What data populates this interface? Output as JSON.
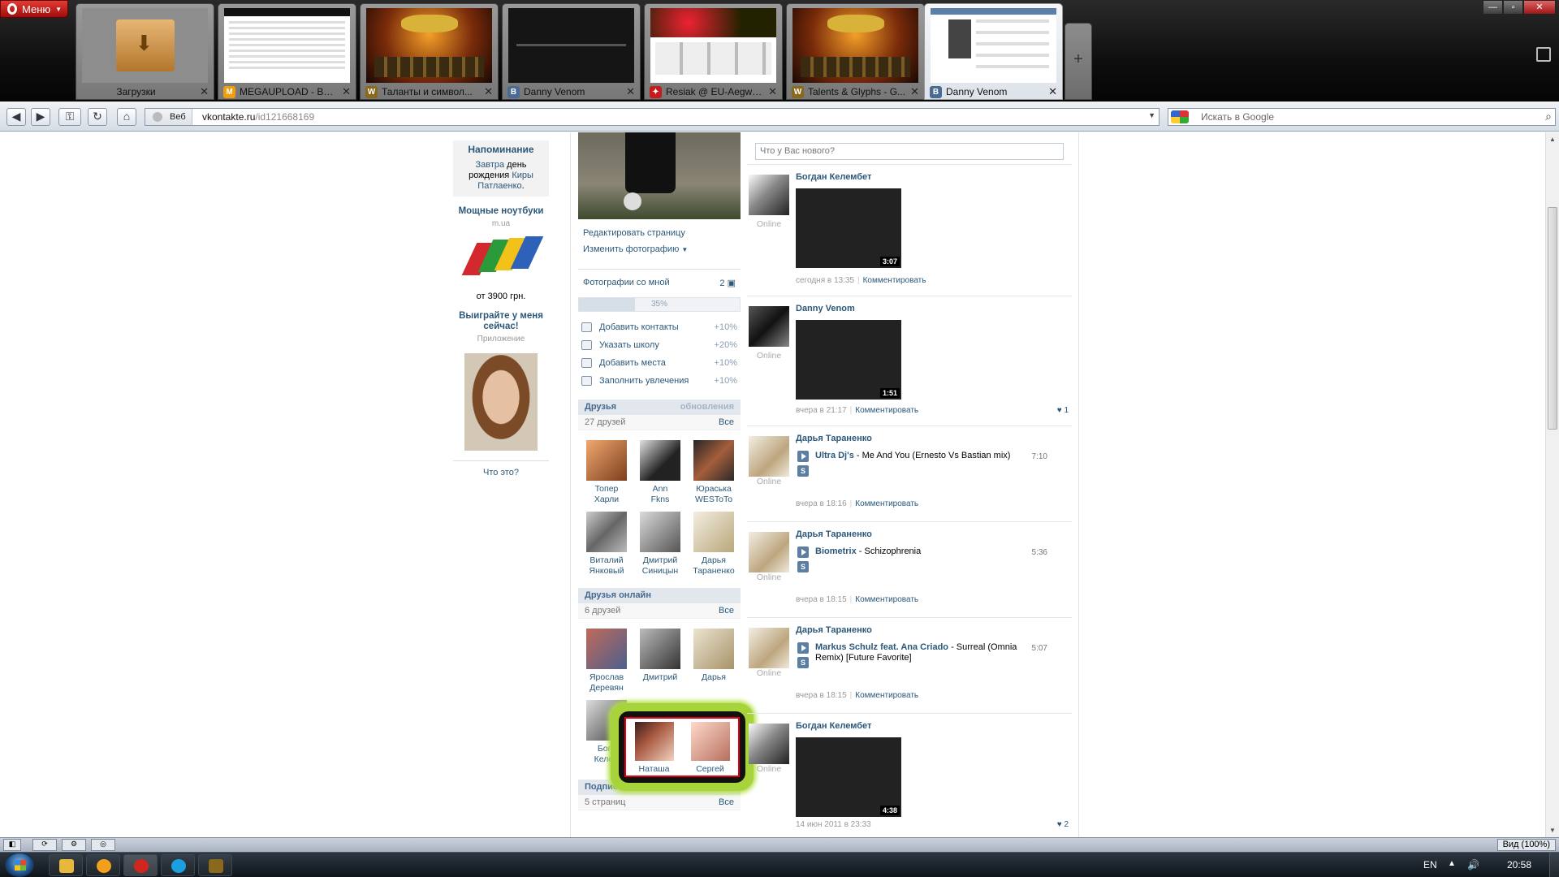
{
  "browser": {
    "menu_label": "Меню",
    "tabs": [
      {
        "label": "Загрузки",
        "favicon": "",
        "kind": "downloads",
        "has_close": true
      },
      {
        "label": "MEGAUPLOAD - Вед...",
        "favicon": "M",
        "favicon_color": "#f29d0b",
        "kind": "mega",
        "has_close": true
      },
      {
        "label": "Таланты и символ...",
        "favicon": "W",
        "favicon_color": "#8a6a1a",
        "kind": "wow",
        "has_close": true
      },
      {
        "label": "Danny Venom",
        "favicon": "B",
        "favicon_color": "#4a6c94",
        "kind": "dark",
        "has_close": true
      },
      {
        "label": "Resiak @ EU-Aegwy...",
        "favicon": "✦",
        "favicon_color": "#c21c1c",
        "kind": "resiak",
        "has_close": true
      },
      {
        "label": "Talents & Glyphs - G...",
        "favicon": "W",
        "favicon_color": "#8a6a1a",
        "kind": "wow",
        "has_close": true
      },
      {
        "label": "Danny Venom",
        "favicon": "B",
        "favicon_color": "#4a6c94",
        "kind": "vk",
        "active": true,
        "has_close": true
      }
    ],
    "new_tab_icon": "+",
    "address": {
      "site_label": "Веб",
      "host": "vkontakte.ru",
      "path": "/id121668169"
    },
    "search": {
      "engine_icon": "google-icon",
      "placeholder": "Искать в Google"
    },
    "zoom_label": "Вид (100%)"
  },
  "sidebar": {
    "reminder": {
      "title": "Напоминание",
      "line1_link": "Завтра",
      "line1_text": " день рождения ",
      "line1_name1": "Киры",
      "line1_name2": "Патлаенко",
      "line1_end": "."
    },
    "ad1": {
      "title": "Мощные ноутбуки",
      "domain": "m.ua",
      "price": "от 3900 грн."
    },
    "ad2": {
      "title": "Выиграйте у меня сейчас!",
      "sub": "Приложение"
    },
    "what_is": "Что это?"
  },
  "profile": {
    "edit_page": "Редактировать страницу",
    "change_photo": "Изменить фотографию",
    "photos_with_me": "Фотографии со мной",
    "photos_count": "2",
    "progress": {
      "percent_label": "35%",
      "value": 0.35
    },
    "tasks": [
      {
        "label": "Добавить контакты",
        "points": "+10%",
        "icon": "contacts-icon"
      },
      {
        "label": "Указать школу",
        "points": "+20%",
        "icon": "school-icon"
      },
      {
        "label": "Добавить места",
        "points": "+10%",
        "icon": "places-icon"
      },
      {
        "label": "Заполнить увлечения",
        "points": "+10%",
        "icon": "interests-icon"
      }
    ],
    "friends": {
      "title": "Друзья",
      "updates": "обновления",
      "count": "27 друзей",
      "all": "Все",
      "items": [
        {
          "name1": "Топер",
          "name2": "Харли"
        },
        {
          "name1": "Ann",
          "name2": "Fkns"
        },
        {
          "name1": "Юраська",
          "name2": "WESToTo"
        },
        {
          "name1": "Виталий",
          "name2": "Янковый"
        },
        {
          "name1": "Дмитрий",
          "name2": "Синицын"
        },
        {
          "name1": "Дарья",
          "name2": "Тараненко"
        }
      ]
    },
    "online": {
      "title": "Друзья онлайн",
      "count": "6 друзей",
      "all": "Все",
      "items": [
        {
          "name1": "Ярослав",
          "name2": "Деревян"
        },
        {
          "name1": "Дмитрий",
          "name2": ""
        },
        {
          "name1": "Дарья",
          "name2": ""
        },
        {
          "name1": "Богд",
          "name2": "Келем"
        }
      ],
      "highlighted": [
        {
          "name": "Наташа"
        },
        {
          "name": "Сергей"
        }
      ]
    },
    "subscriptions": {
      "title": "Подписки",
      "count": "5 страниц",
      "all": "Все"
    }
  },
  "feed": {
    "status_placeholder": "Что у Вас нового?",
    "posts": [
      {
        "author": "Богдан Келембет",
        "online": "Online",
        "type": "video",
        "duration": "3:07",
        "time": "сегодня в 13:35",
        "comment": "Комментировать",
        "likes": ""
      },
      {
        "author": "Danny Venom",
        "online": "Online",
        "type": "video",
        "duration": "1:51",
        "time": "вчера в 21:17",
        "comment": "Комментировать",
        "likes": "1"
      },
      {
        "author": "Дарья Тараненко",
        "online": "Online",
        "type": "audio",
        "artist": "Ultra Dj's",
        "track": " - Me And You (Ernesto Vs Bastian mix)",
        "duration": "7:10",
        "time": "вчера в 18:16",
        "comment": "Комментировать"
      },
      {
        "author": "Дарья Тараненко",
        "online": "Online",
        "type": "audio",
        "artist": "Biometrix",
        "track": " - Schizophrenia",
        "duration": "5:36",
        "time": "вчера в 18:15",
        "comment": "Комментировать"
      },
      {
        "author": "Дарья Тараненко",
        "online": "Online",
        "type": "audio",
        "artist": "Markus Schulz feat. Ana Criado",
        "track": " - Surreal (Omnia Remix) [Future Favorite]",
        "duration": "5:07",
        "time": "вчера в 18:15",
        "comment": "Комментировать"
      },
      {
        "author": "Богдан Келембет",
        "online": "Online",
        "type": "video",
        "duration": "4:38",
        "time": "14 июн 2011 в 23:33",
        "comment": "",
        "likes": "2"
      }
    ]
  },
  "taskbar": {
    "lang": "EN",
    "clock": "20:58",
    "apps": [
      {
        "name": "explorer",
        "color": "#e8b83b"
      },
      {
        "name": "aimp",
        "color": "#f2a01c"
      },
      {
        "name": "opera",
        "color": "#d0261f"
      },
      {
        "name": "skype",
        "color": "#1aa0e0"
      },
      {
        "name": "wow",
        "color": "#8a6a1a"
      }
    ]
  }
}
